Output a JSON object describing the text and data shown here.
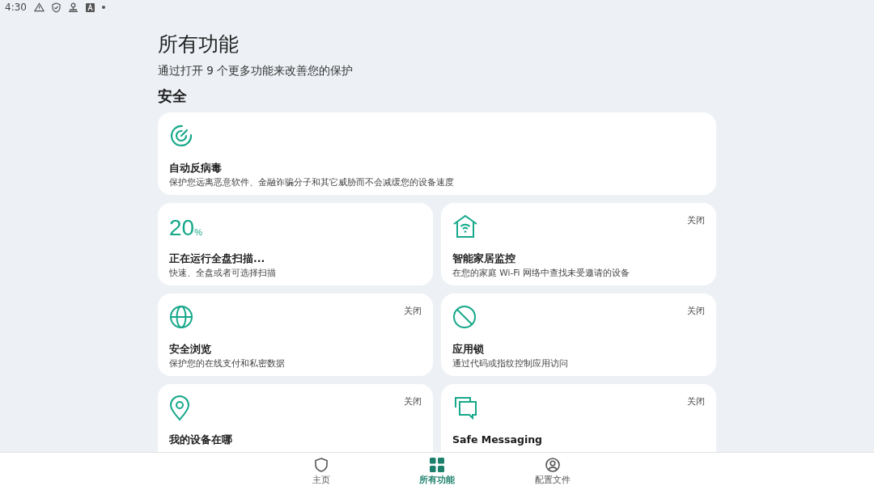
{
  "status_bar": {
    "time": "4:30"
  },
  "header": {
    "title": "所有功能",
    "subtitle": "通过打开 9 个更多功能来改善您的保护"
  },
  "section": {
    "title": "安全"
  },
  "features": [
    {
      "kind": "icon",
      "wide": true,
      "title": "自动反病毒",
      "description": "保护您远离恶意软件、金融诈骗分子和其它威胁而不会减缓您的设备速度"
    },
    {
      "kind": "progress",
      "wide": false,
      "value": "20",
      "unit": "%",
      "title": "正在运行全盘扫描...",
      "description": "快速、全盘或者可选择扫描"
    },
    {
      "kind": "icon",
      "wide": false,
      "status": "关闭",
      "title": "智能家居监控",
      "description": "在您的家庭 Wi-Fi 网络中查找未受邀请的设备"
    },
    {
      "kind": "icon",
      "wide": false,
      "status": "关闭",
      "title": "安全浏览",
      "description": "保护您的在线支付和私密数据"
    },
    {
      "kind": "icon",
      "wide": false,
      "status": "关闭",
      "title": "应用锁",
      "description": "通过代码或指纹控制应用访问"
    },
    {
      "kind": "icon",
      "wide": false,
      "status": "关闭",
      "title": "我的设备在哪"
    },
    {
      "kind": "icon",
      "wide": false,
      "status": "关闭",
      "title": "Safe Messaging"
    }
  ],
  "nav": [
    {
      "label": "主页",
      "selected": false
    },
    {
      "label": "所有功能",
      "selected": true
    },
    {
      "label": "配置文件",
      "selected": false
    }
  ]
}
